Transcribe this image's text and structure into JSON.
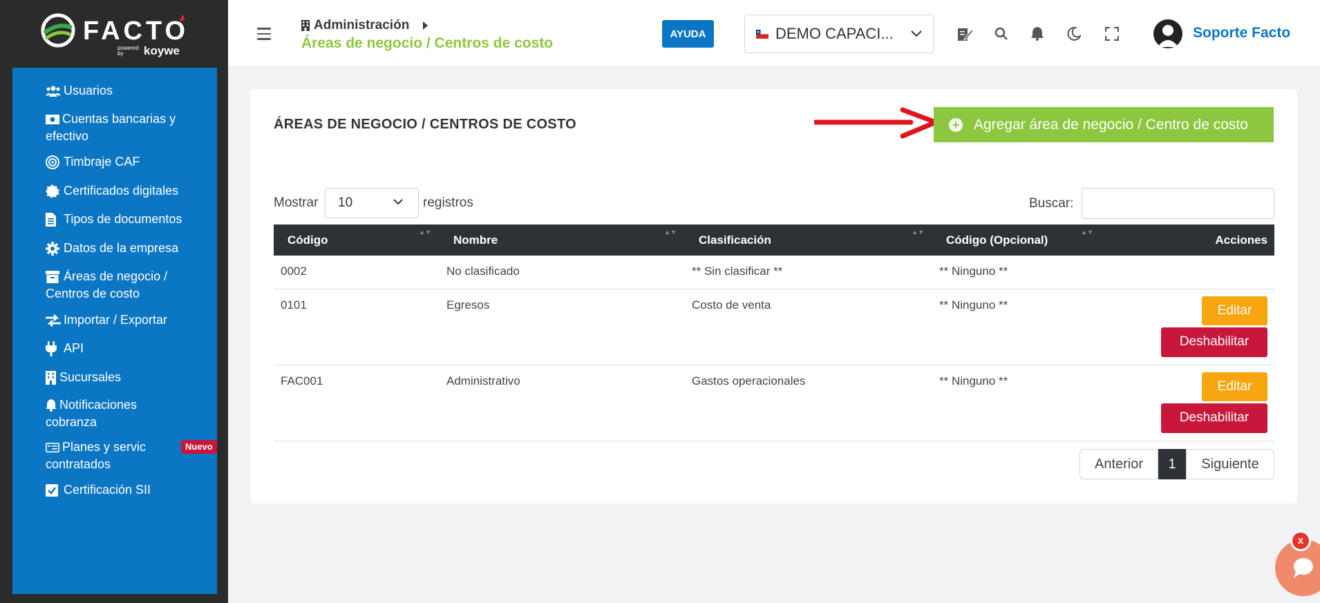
{
  "brand": {
    "name": "FACTO",
    "powered": "powered by",
    "partner": "koywe"
  },
  "sidebar": {
    "items": [
      {
        "label": "Usuarios",
        "icon": "users-icon"
      },
      {
        "label": "Cuentas bancarias y efectivo",
        "icon": "money-icon"
      },
      {
        "label": "Timbraje CAF",
        "icon": "target-icon"
      },
      {
        "label": "Certificados digitales",
        "icon": "certificate-icon"
      },
      {
        "label": "Tipos de documentos",
        "icon": "document-icon"
      },
      {
        "label": "Datos de la empresa",
        "icon": "gear-icon"
      },
      {
        "label": "Áreas de negocio / Centros de costo",
        "icon": "archive-icon"
      },
      {
        "label": "Importar / Exportar",
        "icon": "exchange-icon"
      },
      {
        "label": "API",
        "icon": "plug-icon"
      },
      {
        "label": "Sucursales",
        "icon": "building-icon"
      },
      {
        "label": "Notificaciones cobranza",
        "icon": "bell-icon"
      },
      {
        "label": "Planes y servic",
        "label2": "contratados",
        "icon": "plan-card-icon",
        "badge": "Nuevo"
      },
      {
        "label": "Certificación SII",
        "icon": "checkbox-icon"
      }
    ]
  },
  "header": {
    "breadcrumb_parent": "Administración",
    "breadcrumb_current": "Áreas de negocio / Centros de costo",
    "help_label": "AYUDA",
    "company": "DEMO CAPACI...",
    "user_name": "Soporte Facto"
  },
  "main": {
    "title": "ÁREAS DE NEGOCIO / CENTROS DE COSTO",
    "add_label": "Agregar área de negocio / Centro de costo",
    "show_label": "Mostrar",
    "page_size": "10",
    "records_label": "registros",
    "search_label": "Buscar:",
    "search_value": "",
    "columns": [
      "Código",
      "Nombre",
      "Clasificación",
      "Código (Opcional)",
      "Acciones"
    ],
    "rows": [
      {
        "codigo": "0002",
        "nombre": "No clasificado",
        "clasificacion": "** Sin clasificar **",
        "opcional": "** Ninguno **"
      },
      {
        "codigo": "0101",
        "nombre": "Egresos",
        "clasificacion": "Costo de venta",
        "opcional": "** Ninguno **",
        "edit": "Editar",
        "disable": "Deshabilitar"
      },
      {
        "codigo": "FAC001",
        "nombre": "Administrativo",
        "clasificacion": "Gastos operacionales",
        "opcional": "** Ninguno **",
        "edit": "Editar",
        "disable": "Deshabilitar"
      }
    ],
    "pagination": {
      "prev": "Anterior",
      "current": "1",
      "next": "Siguiente"
    }
  },
  "chat": {
    "close_label": "x"
  },
  "colors": {
    "sidebar_blue": "#0a76c4",
    "green": "#8dc63f",
    "edit_orange": "#f9a50f",
    "disable_red": "#c8173a",
    "dark_header": "#2e3236"
  }
}
